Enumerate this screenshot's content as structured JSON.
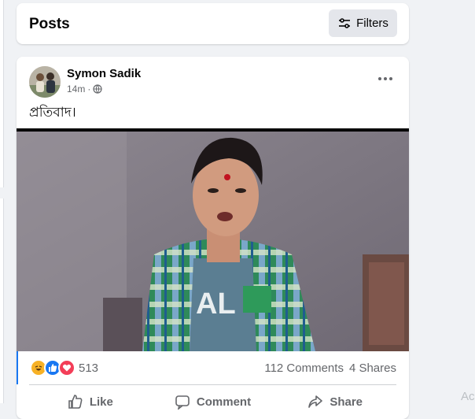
{
  "header": {
    "title": "Posts",
    "filters_label": "Filters"
  },
  "post": {
    "author": "Symon Sadik",
    "time": "14m",
    "time_separator": "·",
    "text": "প্রতিবাদ।",
    "reaction_count": "513",
    "comments": "112 Comments",
    "shares": "4 Shares",
    "reactions": [
      "haha",
      "like",
      "love"
    ]
  },
  "actions": {
    "like": "Like",
    "comment": "Comment",
    "share": "Share"
  },
  "side_text": "Ac",
  "colors": {
    "accent": "#1877f2",
    "love": "#f33e58",
    "haha": "#f7b125",
    "secondary_text": "#65676b"
  }
}
